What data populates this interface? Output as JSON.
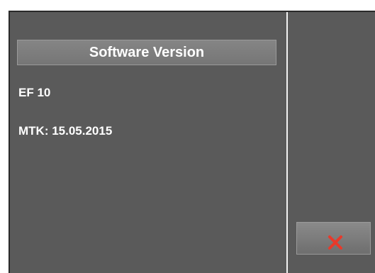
{
  "dialog": {
    "title": "Software Version",
    "lines": [
      "EF 10",
      "MTK: 15.05.2015"
    ]
  },
  "actions": {
    "close_icon": "close-icon",
    "close_icon_color": "#e8392a"
  },
  "colors": {
    "panel_background": "#5a5a5a",
    "title_bar": "#7d7d7d",
    "text": "#ffffff"
  }
}
